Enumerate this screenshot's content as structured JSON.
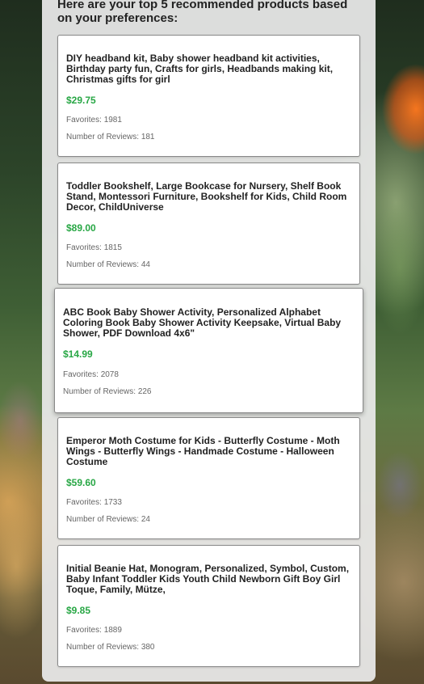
{
  "heading": "Here are your top 5 recommended products based on your preferences:",
  "favorites_label": "Favorites:",
  "reviews_label": "Number of Reviews:",
  "colors": {
    "price": "#28a745",
    "card_border": "#888888"
  },
  "products": [
    {
      "title": "DIY headband kit, Baby shower headband kit activities, Birthday party fun, Crafts for girls, Headbands making kit, Christmas gifts for girl",
      "price": "$29.75",
      "favorites": "1981",
      "reviews": "181"
    },
    {
      "title": "Toddler Bookshelf, Large Bookcase for Nursery, Shelf Book Stand, Montessori Furniture, Bookshelf for Kids, Child Room Decor, ChildUniverse",
      "price": "$89.00",
      "favorites": "1815",
      "reviews": "44"
    },
    {
      "title": "ABC Book Baby Shower Activity, Personalized Alphabet Coloring Book Baby Shower Activity Keepsake, Virtual Baby Shower, PDF Download 4x6\"",
      "price": "$14.99",
      "favorites": "2078",
      "reviews": "226"
    },
    {
      "title": "Emperor Moth Costume for Kids - Butterfly Costume - Moth Wings - Butterfly Wings - Handmade Costume - Halloween Costume",
      "price": "$59.60",
      "favorites": "1733",
      "reviews": "24"
    },
    {
      "title": "Initial Beanie Hat, Monogram, Personalized, Symbol, Custom, Baby Infant Toddler Kids Youth Child Newborn Gift Boy Girl Toque, Family, Mütze,",
      "price": "$9.85",
      "favorites": "1889",
      "reviews": "380"
    }
  ]
}
